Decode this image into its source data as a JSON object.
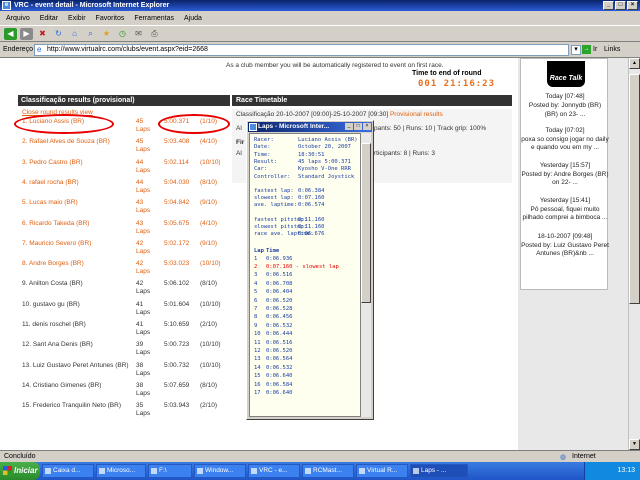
{
  "window": {
    "title": "VRC - event detail - Microsoft Internet Explorer"
  },
  "menu": [
    "Arquivo",
    "Editar",
    "Exibir",
    "Favoritos",
    "Ferramentas",
    "Ajuda"
  ],
  "address": {
    "label": "Endereço",
    "url": "http://www.virtualrc.com/clubs/event.aspx?eid=2668",
    "go": "Ir",
    "links": "Links"
  },
  "page": {
    "intro": "As a club member you will be automatically registered to event on first race.",
    "time_label": "Time to end of round",
    "time_value": "001 21:16:23",
    "results_header": "Classificação results (provisional)",
    "close_link": "Close round results view",
    "results": [
      {
        "name": "1. Luciano Assis (BR)",
        "laps": "45 Laps",
        "time": "5:00.371",
        "rank": "(1/10)"
      },
      {
        "name": "2. Rafael Alves de Souza (BR)",
        "laps": "45 Laps",
        "time": "5:03.408",
        "rank": "(4/10)"
      },
      {
        "name": "3. Pedro Castro (BR)",
        "laps": "44 Laps",
        "time": "5:02.114",
        "rank": "(10/10)"
      },
      {
        "name": "4. rafael rocha (BR)",
        "laps": "44 Laps",
        "time": "5:04.030",
        "rank": "(8/10)"
      },
      {
        "name": "5. Lucas maio (BR)",
        "laps": "43 Laps",
        "time": "5:04.842",
        "rank": "(9/10)"
      },
      {
        "name": "6. Ricardo Takeda (BR)",
        "laps": "43 Laps",
        "time": "5:05.675",
        "rank": "(4/10)"
      },
      {
        "name": "7. Mauricio Severo (BR)",
        "laps": "42 Laps",
        "time": "5:02.172",
        "rank": "(9/10)"
      },
      {
        "name": "8. Andre Borges (BR)",
        "laps": "42 Laps",
        "time": "5:03.023",
        "rank": "(10/10)"
      },
      {
        "name": "9. Anilton Costa (BR)",
        "laps": "42 Laps",
        "time": "5:06.102",
        "rank": "(8/10)"
      },
      {
        "name": "10. gustavo gu (BR)",
        "laps": "41 Laps",
        "time": "5:01.604",
        "rank": "(10/10)"
      },
      {
        "name": "11. denis roschel (BR)",
        "laps": "41 Laps",
        "time": "5:10.659",
        "rank": "(2/10)"
      },
      {
        "name": "12. Sant Ana Denis (BR)",
        "laps": "39 Laps",
        "time": "5:00.723",
        "rank": "(10/10)"
      },
      {
        "name": "13. Luiz Gustavo Peret Antunes (BR)",
        "laps": "38 Laps",
        "time": "5:00.732",
        "rank": "(10/10)"
      },
      {
        "name": "14. Cristiano Gimenes (BR)",
        "laps": "38 Laps",
        "time": "5:07.659",
        "rank": "(8/10)"
      },
      {
        "name": "15. Frederico Tranquilin Neto (BR)",
        "laps": "35 Laps",
        "time": "5:03.943",
        "rank": "(2/10)"
      }
    ],
    "timetable_header": "Race Timetable",
    "timetable": {
      "line1_a": "Classificação",
      "line1_b": "20-10-2007 [09:00]-25-10-2007 [09:30]",
      "line1_link": "Provisional results",
      "line2_a": "Al",
      "line2_b": "pants: 50 | Runs: 10 | Track grip: 100%",
      "line3": "Fir",
      "line4_a": "Al",
      "line4_b": "rticipants: 8 | Runs: 3"
    },
    "sidebar": {
      "logo": "Race Talk",
      "items": [
        "Today [07:48]",
        "Posted by: Jonnydb (BR)",
        "(BR) on 23- ...",
        "Today [07:02]",
        "poxa so consigo jogar no daily e quando vou em my ...",
        "Yesterday [15:57]",
        "Posted by: Andre Borges (BR) on 22- ...",
        "Yesterday [15:41]",
        "Pô pessoal, fiquei muito pilhado comprei a bimboca ...",
        "18-10-2007 [09:48]",
        "Posted by: Luiz Gustavo Peret Antunes (BR)&nb ..."
      ]
    }
  },
  "laps_window": {
    "title": "Laps - Microsoft Inter...",
    "info": [
      {
        "k": "Racer:",
        "v": "Luciano Assis (BR)"
      },
      {
        "k": "Date:",
        "v": "October 20, 2007"
      },
      {
        "k": "Time:",
        "v": "18:30:51"
      },
      {
        "k": "Result:",
        "v": "45 laps  5:00.371"
      },
      {
        "k": "Car:",
        "v": "Kyosho V-One RRR"
      },
      {
        "k": "Controller:",
        "v": "Standard Joystick"
      }
    ],
    "stats": [
      {
        "k": "fastest lap:",
        "v": "0:06.384"
      },
      {
        "k": "slowest lap:",
        "v": "0:07.160"
      },
      {
        "k": "ave. laptime:",
        "v": "0:06.574"
      }
    ],
    "pit": [
      {
        "k": "fastest pitstop:",
        "v": "0:11.160"
      },
      {
        "k": "slowest pitstop:",
        "v": "0:11.160"
      },
      {
        "k": "race ave. laptime:",
        "v": "0:06.676"
      }
    ],
    "lap_header": {
      "n": "Lap",
      "t": "Time"
    },
    "laps": [
      {
        "n": "1",
        "t": "0:06.936"
      },
      {
        "n": "2",
        "t": "0:07.160 - slowest lap"
      },
      {
        "n": "3",
        "t": "0:06.516"
      },
      {
        "n": "4",
        "t": "0:06.708"
      },
      {
        "n": "5",
        "t": "0:06.404"
      },
      {
        "n": "6",
        "t": "0:06.520"
      },
      {
        "n": "7",
        "t": "0:06.528"
      },
      {
        "n": "8",
        "t": "0:06.456"
      },
      {
        "n": "9",
        "t": "0:06.532"
      },
      {
        "n": "10",
        "t": "0:06.444"
      },
      {
        "n": "11",
        "t": "0:06.516"
      },
      {
        "n": "12",
        "t": "0:06.520"
      },
      {
        "n": "13",
        "t": "0:06.564"
      },
      {
        "n": "14",
        "t": "0:06.532"
      },
      {
        "n": "15",
        "t": "0:06.640"
      },
      {
        "n": "16",
        "t": "0:06.584"
      },
      {
        "n": "17",
        "t": "0:06.640"
      }
    ]
  },
  "status": {
    "left": "Concluído",
    "zone": "Internet"
  },
  "taskbar": {
    "start": "Iniciar",
    "tasks": [
      "Caixa d...",
      "Microso...",
      "F:\\",
      "Window...",
      "VRC - e...",
      "RCMast...",
      "Virtual R...",
      "Laps - ..."
    ],
    "clock": "13:13"
  }
}
